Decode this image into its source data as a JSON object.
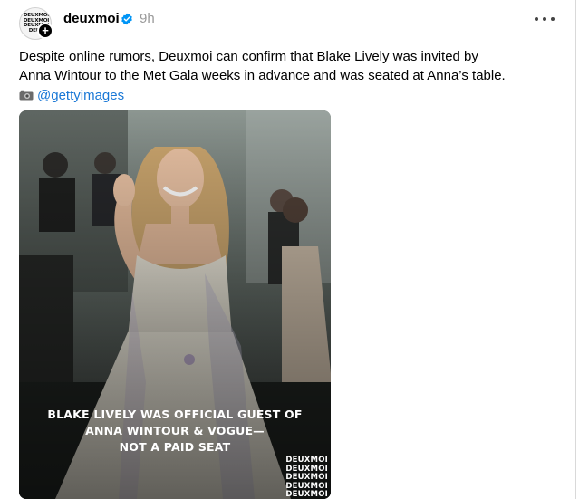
{
  "post": {
    "author": {
      "username": "deuxmoi",
      "avatar_text": "DEUXMOI\nDEUXMOI\nDEUXMOI\nDEUX",
      "verified_icon": "verified-badge-icon"
    },
    "timestamp": "9h",
    "caption_lines": [
      "Despite online rumors, Deuxmoi can confirm that Blake Lively was invited by",
      "Anna Wintour to the Met Gala weeks in advance and was seated at Anna’s table."
    ],
    "credit_handle": "@gettyimages",
    "media": {
      "overlay_lines": [
        "BLAKE LIVELY WAS OFFICIAL GUEST OF",
        "ANNA WINTOUR & VOGUE—",
        "NOT A PAID SEAT"
      ],
      "watermark_lines": [
        "DEUXMOI",
        "DEUXMOI",
        "DEUXMOI",
        "DEUXMOI",
        "DEUXMOI"
      ]
    }
  },
  "colors": {
    "link": "#1877d6",
    "verified": "#0095f6",
    "muted": "#999999"
  }
}
